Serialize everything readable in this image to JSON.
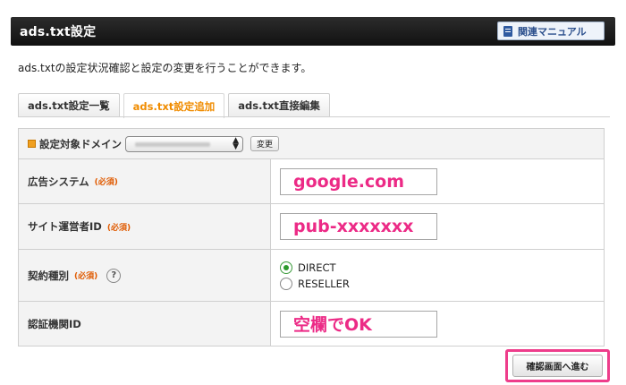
{
  "header": {
    "title": "ads.txt設定",
    "manual_label": "関連マニュアル"
  },
  "description": "ads.txtの設定状況確認と設定の変更を行うことができます。",
  "tabs": [
    {
      "label": "ads.txt設定一覧",
      "active": false
    },
    {
      "label": "ads.txt設定追加",
      "active": true
    },
    {
      "label": "ads.txt直接編集",
      "active": false
    }
  ],
  "domain": {
    "label": "設定対象ドメイン",
    "change_label": "変更"
  },
  "form": {
    "required_label": "(必須)",
    "ad_system": {
      "label": "広告システム",
      "value": "google.com"
    },
    "publisher_id": {
      "label": "サイト運営者ID",
      "value": "pub-xxxxxxx"
    },
    "contract_type": {
      "label": "契約種別",
      "help": "?",
      "options": [
        {
          "label": "DIRECT",
          "selected": true
        },
        {
          "label": "RESELLER",
          "selected": false
        }
      ]
    },
    "cert_id": {
      "label": "認証機関ID",
      "value": "空欄でOK"
    }
  },
  "confirm_label": "確認画面へ進む",
  "colors": {
    "accent_tab": "#f08c00",
    "annotation_pink": "#ec2a86",
    "required": "#e05a00",
    "radio_selected": "#2e9a2e"
  }
}
